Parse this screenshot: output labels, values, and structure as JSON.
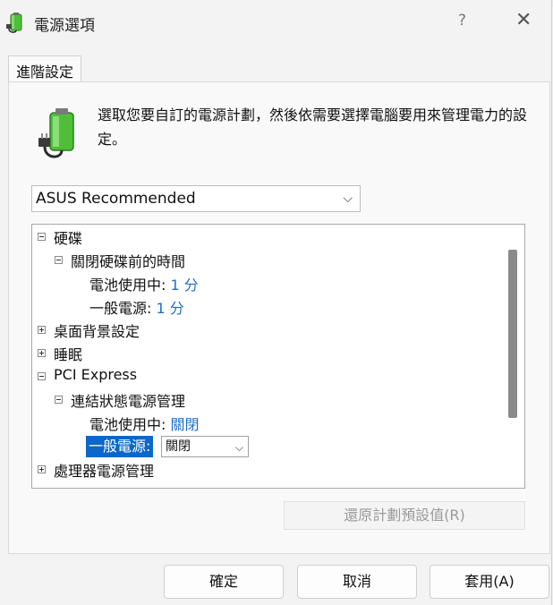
{
  "window": {
    "title": "電源選項",
    "help_label": "?",
    "close_label": "✕"
  },
  "tabs": [
    {
      "label": "進階設定"
    }
  ],
  "description": "選取您要自訂的電源計劃，然後依需要選擇電腦要用來管理電力的設定。",
  "plan_select": {
    "value": "ASUS Recommended"
  },
  "tree": {
    "hard_disk": {
      "label": "硬碟"
    },
    "turn_off_disk": {
      "label": "關閉硬碟前的時間"
    },
    "disk_on_battery": {
      "label": "電池使用中:",
      "value": "1 分"
    },
    "disk_plugged_in": {
      "label": "一般電源:",
      "value": "1 分"
    },
    "desktop_bg": {
      "label": "桌面背景設定"
    },
    "sleep": {
      "label": "睡眠"
    },
    "pci_express": {
      "label": "PCI Express"
    },
    "link_state": {
      "label": "連結狀態電源管理"
    },
    "pci_on_battery": {
      "label": "電池使用中:",
      "value": "關閉"
    },
    "pci_plugged_in": {
      "label": "一般電源:",
      "value": "關閉"
    },
    "processor": {
      "label": "處理器電源管理"
    }
  },
  "restore_button": {
    "label": "還原計劃預設值(R)"
  },
  "footer": {
    "ok": "確定",
    "cancel": "取消",
    "apply": "套用(A)"
  },
  "colors": {
    "accent": "#0b67c9",
    "link": "#1f6ec5",
    "battery_green": "#4fbf3a"
  }
}
